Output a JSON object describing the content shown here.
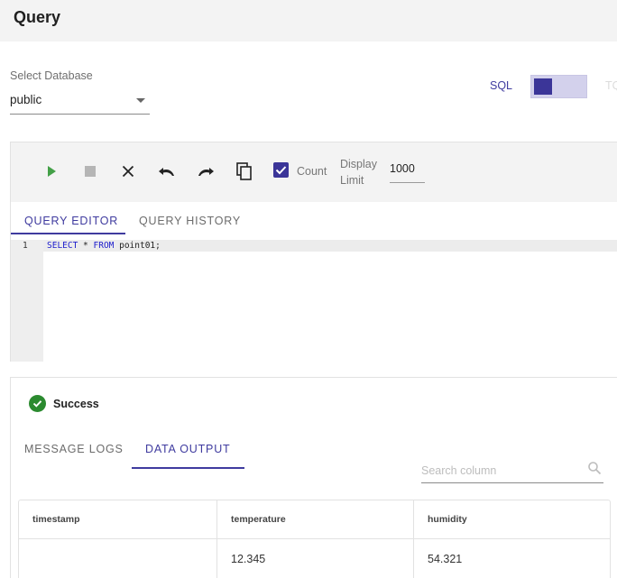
{
  "page": {
    "title": "Query"
  },
  "database": {
    "label": "Select Database",
    "value": "public"
  },
  "mode": {
    "left_label": "SQL",
    "right_label": "TQL"
  },
  "toolbar": {
    "run_icon": "play-icon",
    "stop_icon": "stop-icon",
    "clear_icon": "close-icon",
    "undo_icon": "undo-icon",
    "redo_icon": "redo-icon",
    "copy_icon": "copy-icon",
    "count_checked": true,
    "count_label": "Count",
    "limit_label": "Display Limit",
    "limit_value": "1000"
  },
  "editor_tabs": [
    {
      "label": "QUERY EDITOR",
      "active": true
    },
    {
      "label": "QUERY HISTORY",
      "active": false
    }
  ],
  "editor": {
    "lines": [
      {
        "number": "1",
        "keyword1": "SELECT",
        "middle": " * ",
        "keyword2": "FROM",
        "rest": " point01;"
      }
    ]
  },
  "result": {
    "status": "Success",
    "tabs": [
      {
        "label": "MESSAGE LOGS",
        "active": false
      },
      {
        "label": "DATA OUTPUT",
        "active": true
      }
    ],
    "search_placeholder": "Search column",
    "columns": [
      "timestamp",
      "temperature",
      "humidity"
    ],
    "rows": [
      [
        "",
        "12.345",
        "54.321"
      ]
    ]
  },
  "colors": {
    "accent": "#3f3b9f",
    "success": "#2b8a2f",
    "run": "#43a047",
    "toolbar_bg": "#f3f3f3"
  }
}
